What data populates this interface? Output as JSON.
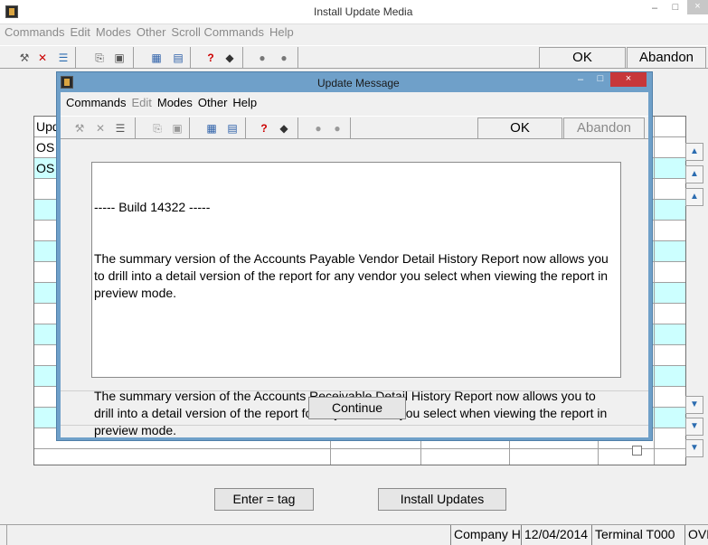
{
  "window": {
    "title": "Install Update Media",
    "minimize_icon": "minimize-icon",
    "maximize_icon": "maximize-icon",
    "close_icon": "close-icon"
  },
  "menu": {
    "items": [
      "Commands",
      "Edit",
      "Modes",
      "Other",
      "Scroll Commands",
      "Help"
    ]
  },
  "toolbar": {
    "ok": "OK",
    "abandon": "Abandon"
  },
  "grid": {
    "header_visible": "Upd",
    "rows": [
      "OS",
      "OS",
      "",
      "",
      "",
      "",
      "",
      "",
      "",
      "",
      "",
      "",
      "",
      ""
    ]
  },
  "buttons": {
    "enter_tag": "Enter = tag",
    "install_updates": "Install Updates"
  },
  "status": {
    "company": "Company H",
    "date": "12/04/2014",
    "terminal": "Terminal T000",
    "mode": "OVR"
  },
  "dialog": {
    "title": "Update Message",
    "menu": [
      "Commands",
      "Edit",
      "Modes",
      "Other",
      "Help"
    ],
    "ok": "OK",
    "abandon": "Abandon",
    "message_line1": "----- Build 14322 -----",
    "message_para1": "The summary version of the Accounts Payable Vendor Detail History Report now allows you to drill into a detail version of the report for any vendor you select when viewing the report in preview mode.",
    "message_para2": "The summary version of the Accounts Receivable Detail History Report now allows you to drill into a detail version of the report for any customer you select when viewing the report in preview mode.",
    "continue": "Continue"
  },
  "colors": {
    "row_highlight": "#ccffff",
    "dialog_frame": "#6fa0c9",
    "close_red": "#c7373a"
  }
}
